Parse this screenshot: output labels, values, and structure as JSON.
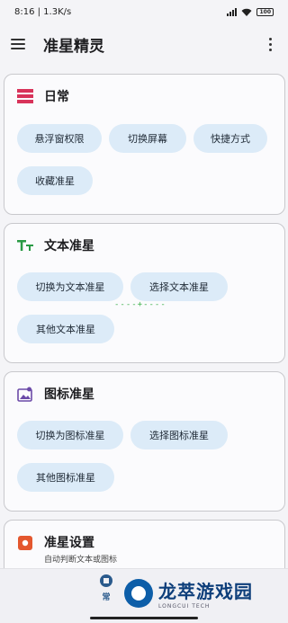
{
  "status_bar": {
    "time_speed": "8:16 | 1.3K/s",
    "battery": "100"
  },
  "app_bar": {
    "title": "准星精灵"
  },
  "sections": {
    "daily": {
      "title": "日常",
      "chips": [
        "悬浮窗权限",
        "切换屏幕",
        "快捷方式",
        "收藏准星"
      ]
    },
    "text": {
      "title": "文本准星",
      "chips": [
        "切换为文本准星",
        "选择文本准星",
        "其他文本准星"
      ],
      "preview_text": "----+----"
    },
    "icon": {
      "title": "图标准星",
      "chips": [
        "切换为图标准星",
        "选择图标准星",
        "其他图标准星"
      ]
    },
    "settings": {
      "title": "准星设置",
      "subtitle": "自动判断文本或图标"
    }
  },
  "bottom_nav": {
    "item_label": "常"
  },
  "watermark": {
    "title": "龙萃游戏园",
    "sub": "LONGCUI TECH"
  },
  "colors": {
    "accent": "#0d5ea8",
    "chip_bg": "#dcebf8",
    "daily_icon": "#d8335a",
    "text_icon": "#2a9a45",
    "icon_icon": "#6b4aa8",
    "settings_icon": "#e4572e",
    "preview": "#3cb04a"
  }
}
